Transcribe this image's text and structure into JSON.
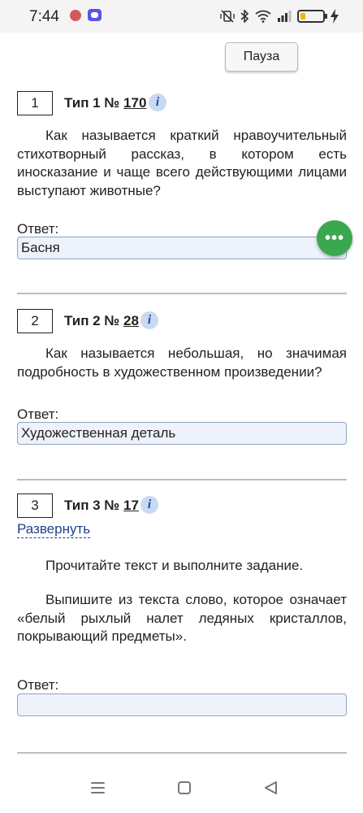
{
  "status_bar": {
    "time": "7:44",
    "icons": [
      "vibrate-off-icon",
      "bluetooth-icon",
      "wifi-icon",
      "signal-icon",
      "battery-icon",
      "charging-icon"
    ],
    "battery_level": 0.15
  },
  "pause_button": {
    "label": "Пауза"
  },
  "fab": {
    "icon": "more-icon",
    "label": "•••",
    "color": "#3aa84f"
  },
  "answer_label": "Ответ:",
  "tasks": [
    {
      "number": "1",
      "type_prefix": "Тип 1 №",
      "type_link": "170",
      "info": "i",
      "text": "Как называется краткий нравоучительный стихотворный рассказ, в котором есть иносказание и чаще всего действующими лицами выступают животные?",
      "answer_value": "Басня"
    },
    {
      "number": "2",
      "type_prefix": "Тип 2 №",
      "type_link": "28",
      "info": "i",
      "text": "Как называется небольшая, но значимая подробность в художественном произведении?",
      "answer_value": "Художественная деталь"
    },
    {
      "number": "3",
      "type_prefix": "Тип 3 №",
      "type_link": "17",
      "info": "i",
      "expand_label": "Развернуть",
      "instruction": "Прочитайте текст и выполните задание.",
      "text": "Выпишите из текста слово, которое означает «белый рыхлый налет ледяных кристаллов, покрывающий предметы».",
      "answer_value": ""
    }
  ],
  "nav_bar": {
    "icons": [
      "menu-icon",
      "home-icon",
      "back-icon"
    ]
  }
}
